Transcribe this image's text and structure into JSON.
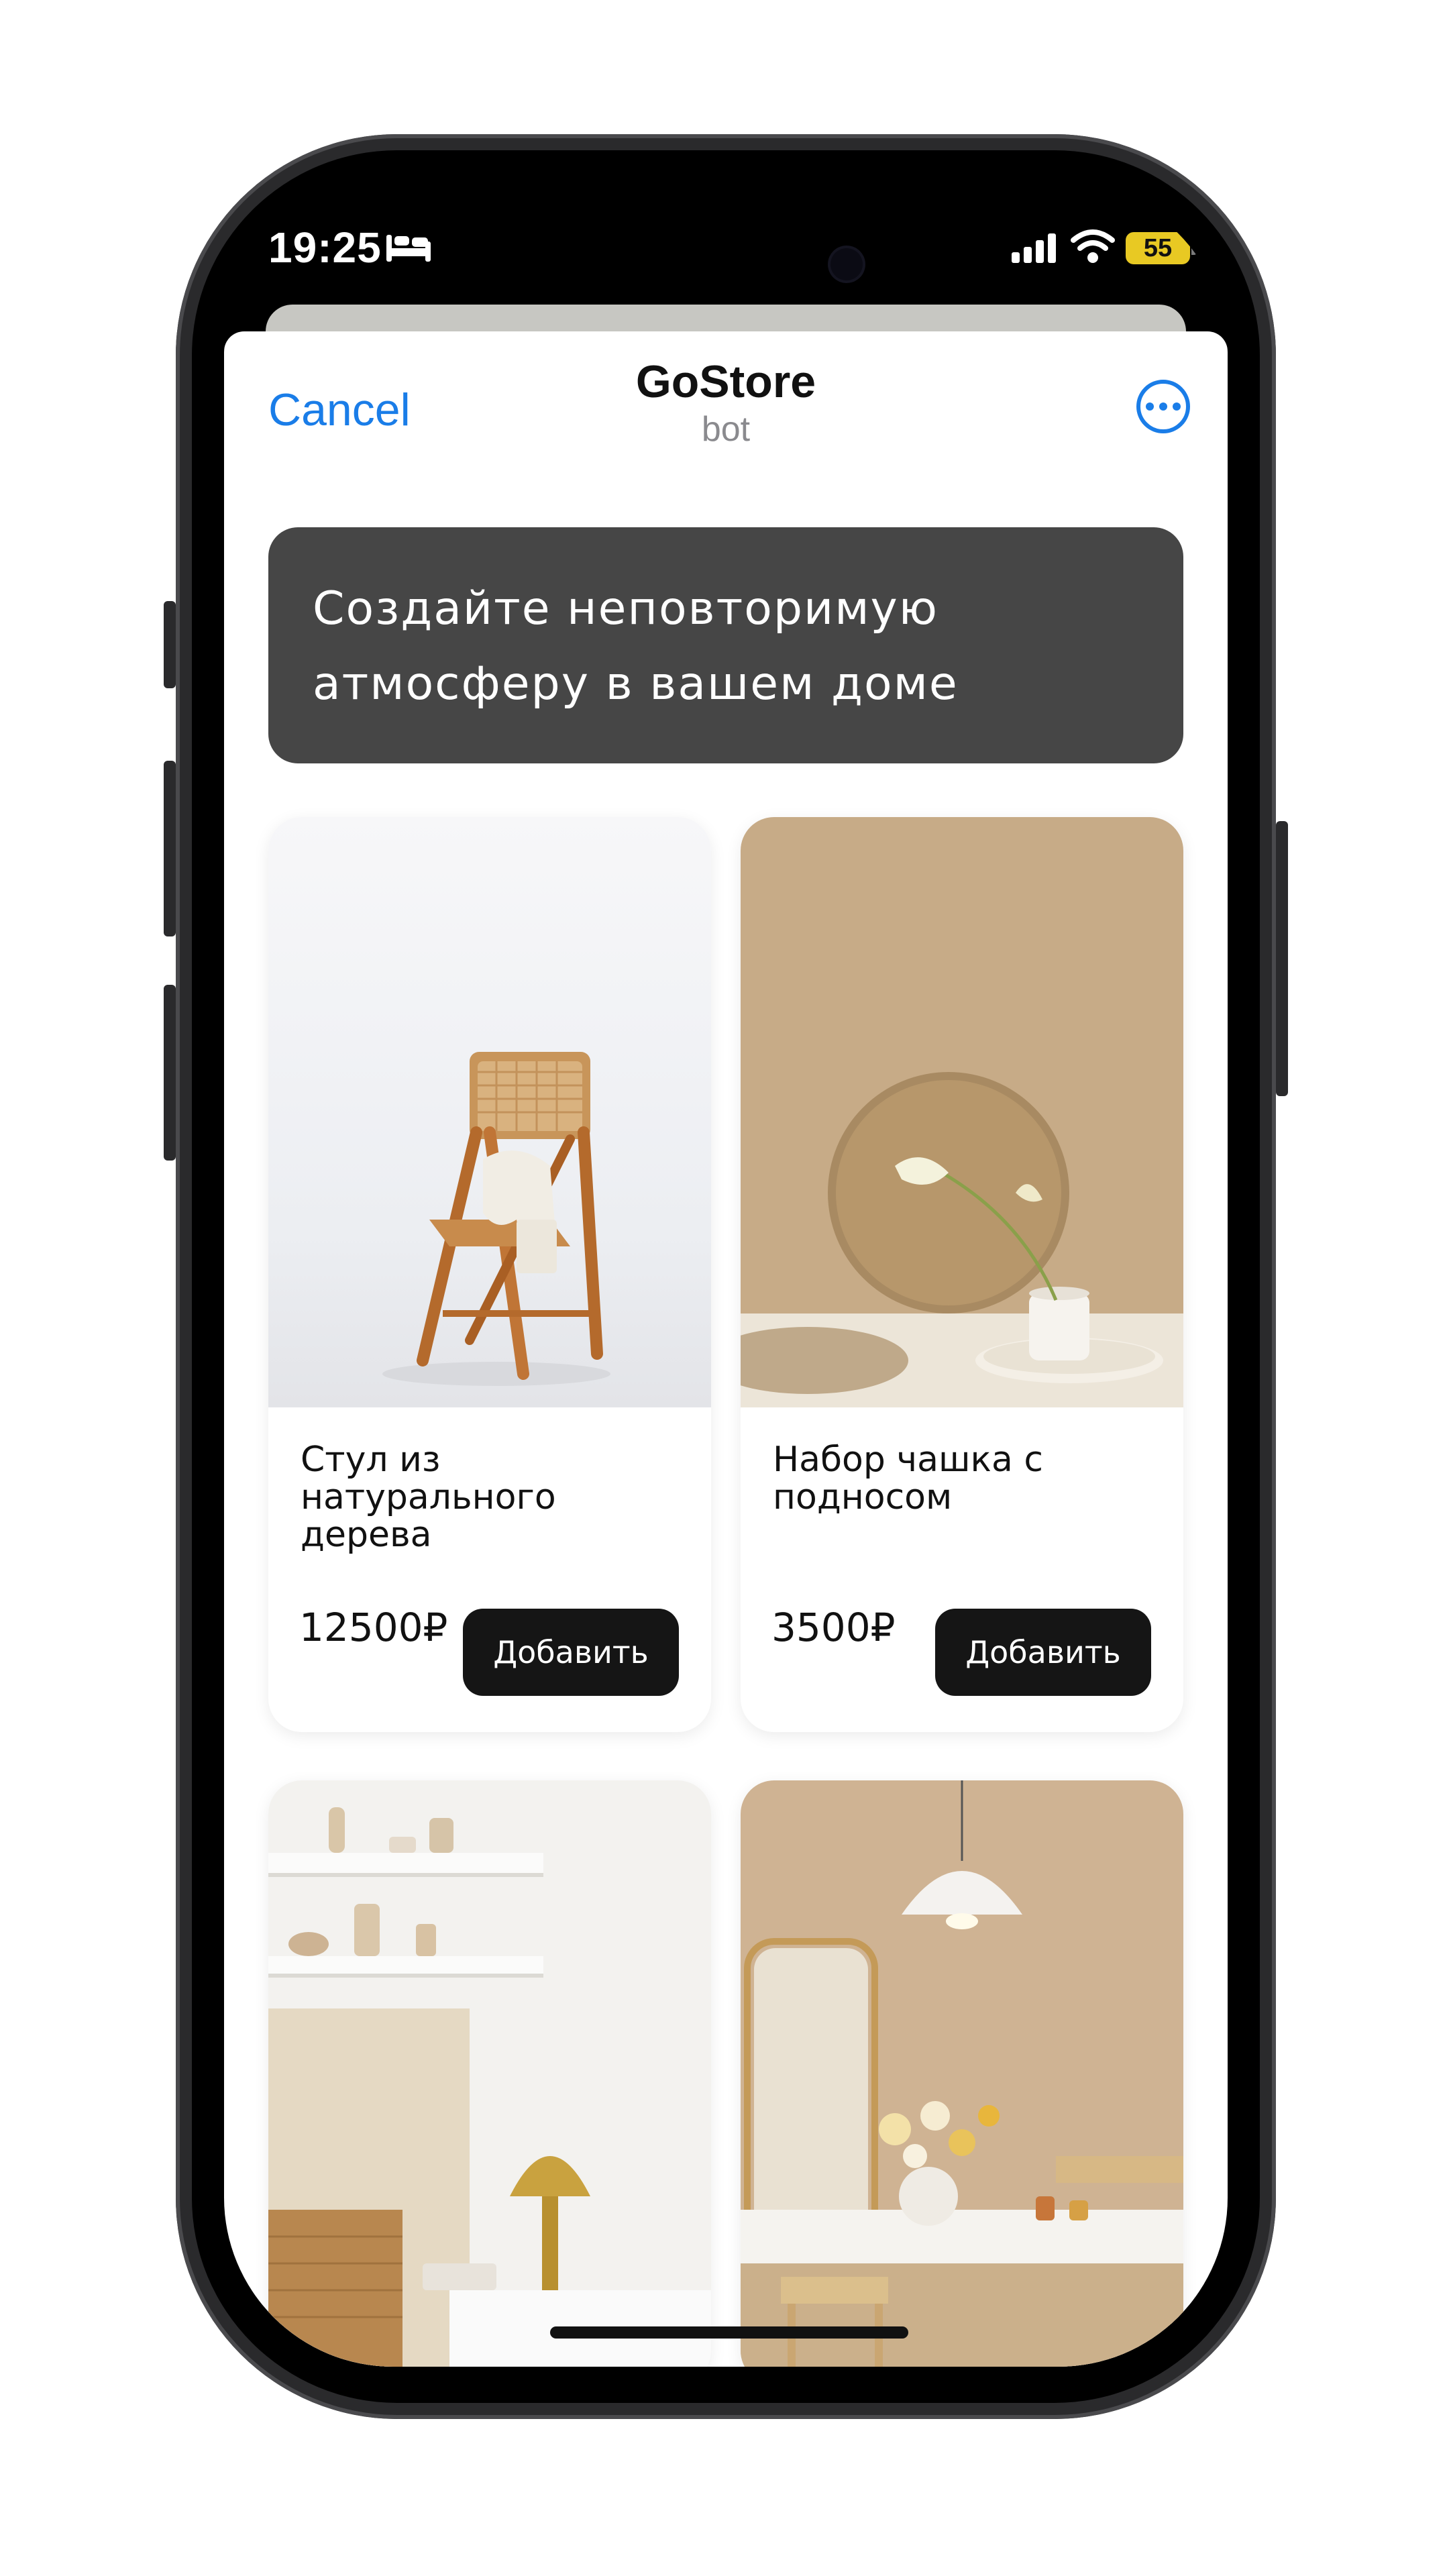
{
  "status_bar": {
    "time": "19:25",
    "battery": "55",
    "icons": [
      "bed-icon",
      "cellular-signal-icon",
      "wifi-icon",
      "battery-icon"
    ]
  },
  "header": {
    "cancel_label": "Cancel",
    "title": "GoStore",
    "subtitle": "bot",
    "more_icon": "more-options-icon"
  },
  "banner": {
    "text": "Создайте неповторимую атмосферу в вашем доме"
  },
  "products": [
    {
      "name": "Стул из натурального дерева",
      "price": "12500₽",
      "button": "Добавить",
      "image": "chair-photo"
    },
    {
      "name": "Набор чашка с подносом",
      "price": "3500₽",
      "button": "Добавить",
      "image": "cup-tray-photo"
    },
    {
      "name": "",
      "price": "",
      "button": "",
      "image": "shelves-lamp-photo"
    },
    {
      "name": "",
      "price": "",
      "button": "",
      "image": "dining-pendant-photo"
    }
  ],
  "colors": {
    "accent": "#1a7de8",
    "banner": "#464646",
    "button": "#151515",
    "battery": "#e8c923"
  }
}
